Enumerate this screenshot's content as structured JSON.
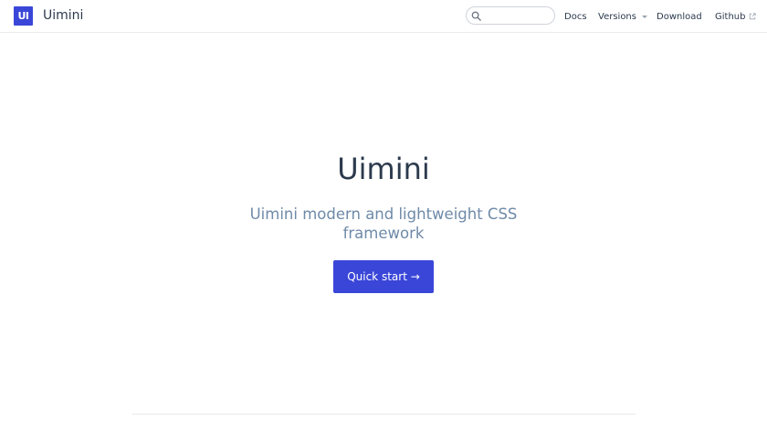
{
  "brand": {
    "logo_text": "UI",
    "name": "Uimini",
    "accent_color": "#3a46d8"
  },
  "search": {
    "placeholder": "",
    "value": "",
    "icon": "search-icon"
  },
  "nav": {
    "docs": "Docs",
    "versions": "Versions",
    "download": "Download",
    "github": "Github"
  },
  "hero": {
    "title": "Uimini",
    "subtitle": "Uimini modern and lightweight CSS framework",
    "cta_label": "Quick start →"
  }
}
